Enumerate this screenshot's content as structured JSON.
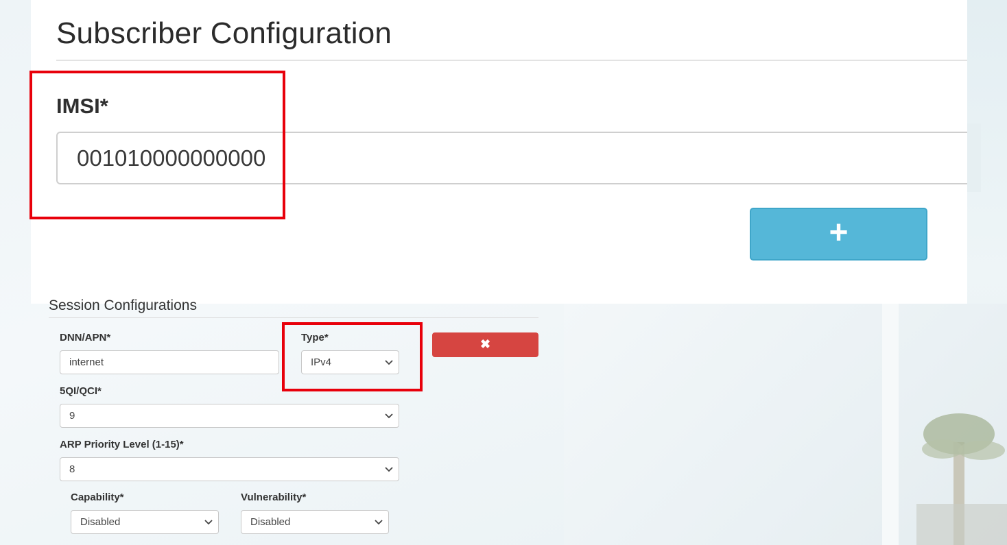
{
  "page": {
    "title": "Subscriber Configuration"
  },
  "imsi": {
    "label": "IMSI*",
    "value": "001010000000000"
  },
  "add_button": {
    "label": "+"
  },
  "session": {
    "title": "Session Configurations",
    "dnn": {
      "label": "DNN/APN*",
      "value": "internet"
    },
    "type": {
      "label": "Type*",
      "selected": "IPv4"
    },
    "remove_button": {
      "label": "✖"
    },
    "qci": {
      "label": "5QI/QCI*",
      "selected": "9"
    },
    "arp": {
      "label": "ARP Priority Level (1-15)*",
      "selected": "8"
    },
    "capability": {
      "label": "Capability*",
      "selected": "Disabled"
    },
    "vulnerability": {
      "label": "Vulnerability*",
      "selected": "Disabled"
    }
  },
  "colors": {
    "add_button": "#55b7d8",
    "remove_button": "#d64541",
    "highlight": "#e8000b"
  },
  "icons": {
    "add": "plus-icon",
    "remove": "close-icon",
    "select": "chevron-down-icon"
  }
}
